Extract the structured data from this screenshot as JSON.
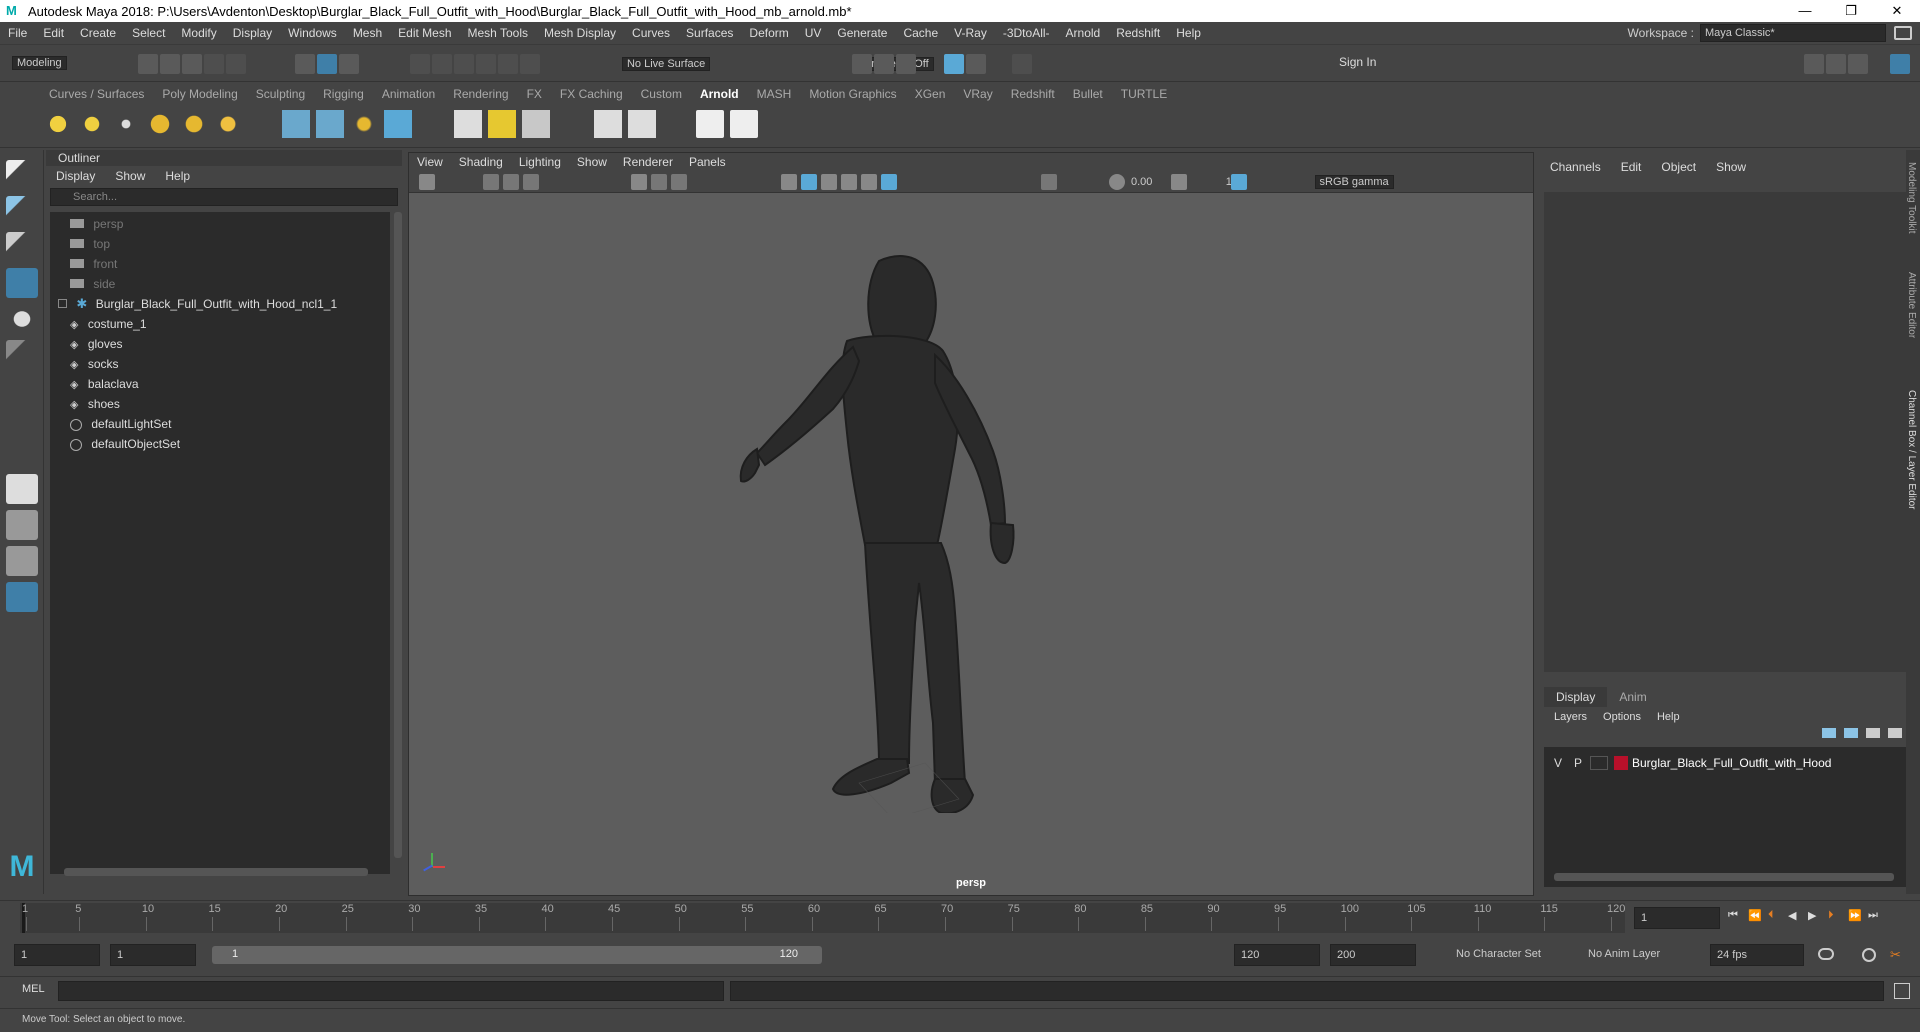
{
  "title": "Autodesk Maya 2018: P:\\Users\\Avdenton\\Desktop\\Burglar_Black_Full_Outfit_with_Hood\\Burglar_Black_Full_Outfit_with_Hood_mb_arnold.mb*",
  "window_buttons": [
    "—",
    "❐",
    "✕"
  ],
  "menus": [
    "File",
    "Edit",
    "Create",
    "Select",
    "Modify",
    "Display",
    "Windows",
    "Mesh",
    "Edit Mesh",
    "Mesh Tools",
    "Mesh Display",
    "Curves",
    "Surfaces",
    "Deform",
    "UV",
    "Generate",
    "Cache",
    "V-Ray",
    "-3DtoAll-",
    "Arnold",
    "Redshift",
    "Help"
  ],
  "workspace": {
    "label": "Workspace :",
    "value": "Maya Classic*"
  },
  "status": {
    "mode": "Modeling",
    "live_surface": "No Live Surface",
    "symmetry": "Symmetry: Off",
    "sign_in": "Sign In"
  },
  "shelf": {
    "tabs": [
      "Curves / Surfaces",
      "Poly Modeling",
      "Sculpting",
      "Rigging",
      "Animation",
      "Rendering",
      "FX",
      "FX Caching",
      "Custom",
      "Arnold",
      "MASH",
      "Motion Graphics",
      "XGen",
      "VRay",
      "Redshift",
      "Bullet",
      "TURTLE"
    ],
    "active_tab": "Arnold"
  },
  "outliner": {
    "title": "Outliner",
    "menu": [
      "Display",
      "Show",
      "Help"
    ],
    "search_placeholder": "Search...",
    "items": [
      {
        "label": "persp",
        "indent": 1,
        "dim": true,
        "icon": "camera-icon"
      },
      {
        "label": "top",
        "indent": 1,
        "dim": true,
        "icon": "camera-icon"
      },
      {
        "label": "front",
        "indent": 1,
        "dim": true,
        "icon": "camera-icon"
      },
      {
        "label": "side",
        "indent": 1,
        "dim": true,
        "icon": "camera-icon"
      },
      {
        "label": "Burglar_Black_Full_Outfit_with_Hood_ncl1_1",
        "indent": 0,
        "dim": false,
        "icon": "group-icon"
      },
      {
        "label": "costume_1",
        "indent": 2,
        "dim": false,
        "icon": "mesh-icon"
      },
      {
        "label": "gloves",
        "indent": 2,
        "dim": false,
        "icon": "mesh-icon"
      },
      {
        "label": "socks",
        "indent": 2,
        "dim": false,
        "icon": "mesh-icon"
      },
      {
        "label": "balaclava",
        "indent": 2,
        "dim": false,
        "icon": "mesh-icon"
      },
      {
        "label": "shoes",
        "indent": 2,
        "dim": false,
        "icon": "mesh-icon"
      },
      {
        "label": "defaultLightSet",
        "indent": 1,
        "dim": false,
        "icon": "set-icon"
      },
      {
        "label": "defaultObjectSet",
        "indent": 1,
        "dim": false,
        "icon": "set-icon"
      }
    ]
  },
  "viewport": {
    "menu": [
      "View",
      "Shading",
      "Lighting",
      "Show",
      "Renderer",
      "Panels"
    ],
    "exposure": "0.00",
    "gamma": "1.00",
    "color_space": "sRGB gamma",
    "camera_label": "persp"
  },
  "channel_box": {
    "menu": [
      "Channels",
      "Edit",
      "Object",
      "Show"
    ],
    "layer_tabs": [
      "Display",
      "Anim"
    ],
    "active_layer_tab": "Display",
    "layer_menu": [
      "Layers",
      "Options",
      "Help"
    ],
    "layer": {
      "v": "V",
      "p": "P",
      "name": "Burglar_Black_Full_Outfit_with_Hood",
      "color": "#b8102a"
    }
  },
  "side_tabs": [
    "Modeling Toolkit",
    "Attribute Editor",
    "Channel Box / Layer Editor"
  ],
  "timeline": {
    "ticks": [
      "1",
      "5",
      "10",
      "15",
      "20",
      "25",
      "30",
      "35",
      "40",
      "45",
      "50",
      "55",
      "60",
      "65",
      "70",
      "75",
      "80",
      "85",
      "90",
      "95",
      "100",
      "105",
      "110",
      "115",
      "120"
    ],
    "current_frame": "1"
  },
  "range": {
    "start": "1",
    "playback_start": "1",
    "slider_start": "1",
    "slider_end": "120",
    "playback_end": "120",
    "end": "200",
    "character_set": "No Character Set",
    "anim_layer": "No Anim Layer",
    "fps": "24 fps"
  },
  "mel": {
    "label": "MEL"
  },
  "help_line": "Move Tool: Select an object to move.",
  "colors": {
    "accent": "#5aa9d6",
    "active_tool": "#3f7fa8",
    "layer": "#b8102a"
  }
}
